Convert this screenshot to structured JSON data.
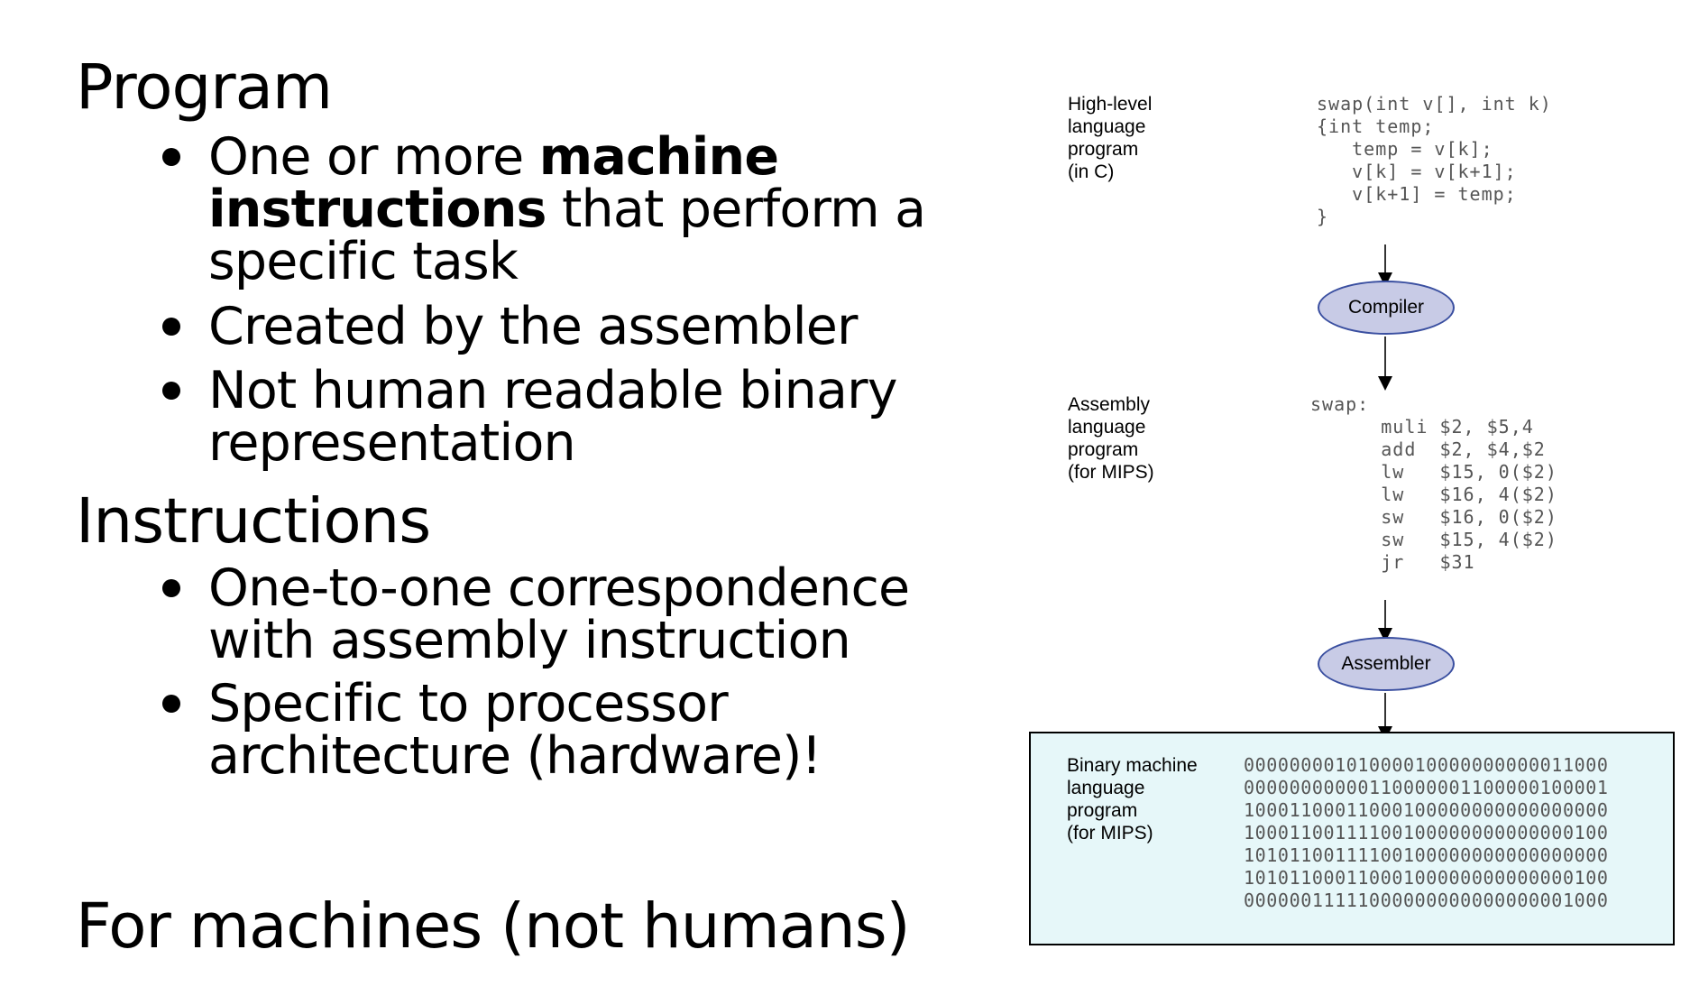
{
  "left": {
    "program_heading": "Program",
    "program_bullets": [
      {
        "text_before": "One or more ",
        "bold": "machine instructions",
        "text_after": " that perform a specific task"
      },
      {
        "text": "Created by the assembler"
      },
      {
        "text": "Not human readable binary representation"
      }
    ],
    "instructions_heading": "Instructions",
    "instructions_bullets": [
      {
        "text": "One-to-one correspondence with assembly instruction"
      },
      {
        "text": "Specific to processor architecture (hardware)!"
      }
    ],
    "footer_heading": "For machines (not humans)"
  },
  "diagram": {
    "high_level": {
      "label": "High-level\nlanguage\nprogram\n(in C)",
      "code": "swap(int v[], int k)\n{int temp;\n   temp = v[k];\n   v[k] = v[k+1];\n   v[k+1] = temp;\n}"
    },
    "compiler": "Compiler",
    "assembly": {
      "label": "Assembly\nlanguage\nprogram\n(for MIPS)",
      "code": "swap:\n      muli $2, $5,4\n      add  $2, $4,$2\n      lw   $15, 0($2)\n      lw   $16, 4($2)\n      sw   $16, 0($2)\n      sw   $15, 4($2)\n      jr   $31"
    },
    "assembler": "Assembler",
    "binary": {
      "label": "Binary machine\nlanguage\nprogram\n(for MIPS)",
      "code": "00000000101000010000000000011000\n00000000000110000001100000100001\n10001100011000100000000000000000\n10001100111100100000000000000100\n10101100111100100000000000000000\n10101100011000100000000000000100\n00000011111000000000000000001000"
    },
    "colors": {
      "ellipse_fill": "#c8cbe6",
      "ellipse_border": "#3a4fa0",
      "binary_box_fill": "#e6f7f9"
    }
  }
}
